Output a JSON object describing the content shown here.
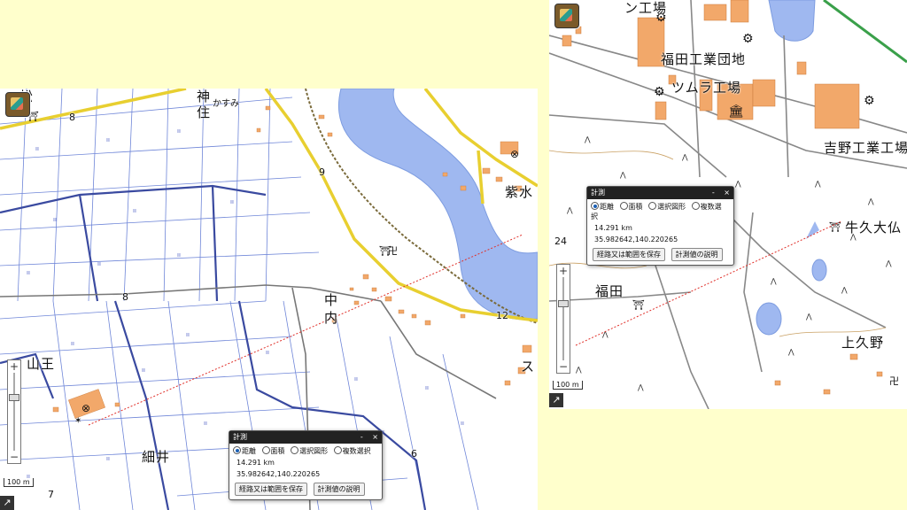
{
  "left_map": {
    "place_labels": {
      "matsu": "松",
      "kami": "神",
      "kasumi": "かすみ",
      "sumi": "住",
      "shimizu": "紫水",
      "nakauchi1": "中",
      "nakauchi2": "内",
      "sanno": "山王",
      "hosoi": "細井",
      "su": "ス"
    },
    "road_numbers": [
      "8",
      "9",
      "8",
      "12",
      "6",
      "7"
    ],
    "scale_text": "100 m"
  },
  "right_map": {
    "place_labels": {
      "kojo_top": "ン工場",
      "fukuda_kogyo": "福田工業団地",
      "tsumura": "ツムラ工場",
      "yoshino": "吉野工業工場",
      "ushiku_daibutsu": "牛久大仏",
      "fukuda": "福田",
      "kamikuno": "上久野"
    },
    "road_numbers": [
      "24"
    ],
    "scale_text": "100 m"
  },
  "measure_panel": {
    "title": "計測",
    "minimize": "-",
    "close": "×",
    "options": [
      "距離",
      "面積",
      "選択図形",
      "複数選択"
    ],
    "selected": "距離",
    "distance": "14.291 km",
    "coords": "35.982642,140.220265",
    "save_button": "経路又は範囲を保存",
    "help_button": "計測値の説明"
  },
  "map_controls": {
    "zoom_in": "+",
    "zoom_out": "−",
    "expand": "↗"
  },
  "colors": {
    "page_bg": "#ffffcc",
    "river": "#9fb8f0",
    "building": "#f2a86a",
    "road_primary": "#f5e04a",
    "field_line": "#4a5dc4",
    "measure_line": "#e0302a"
  }
}
